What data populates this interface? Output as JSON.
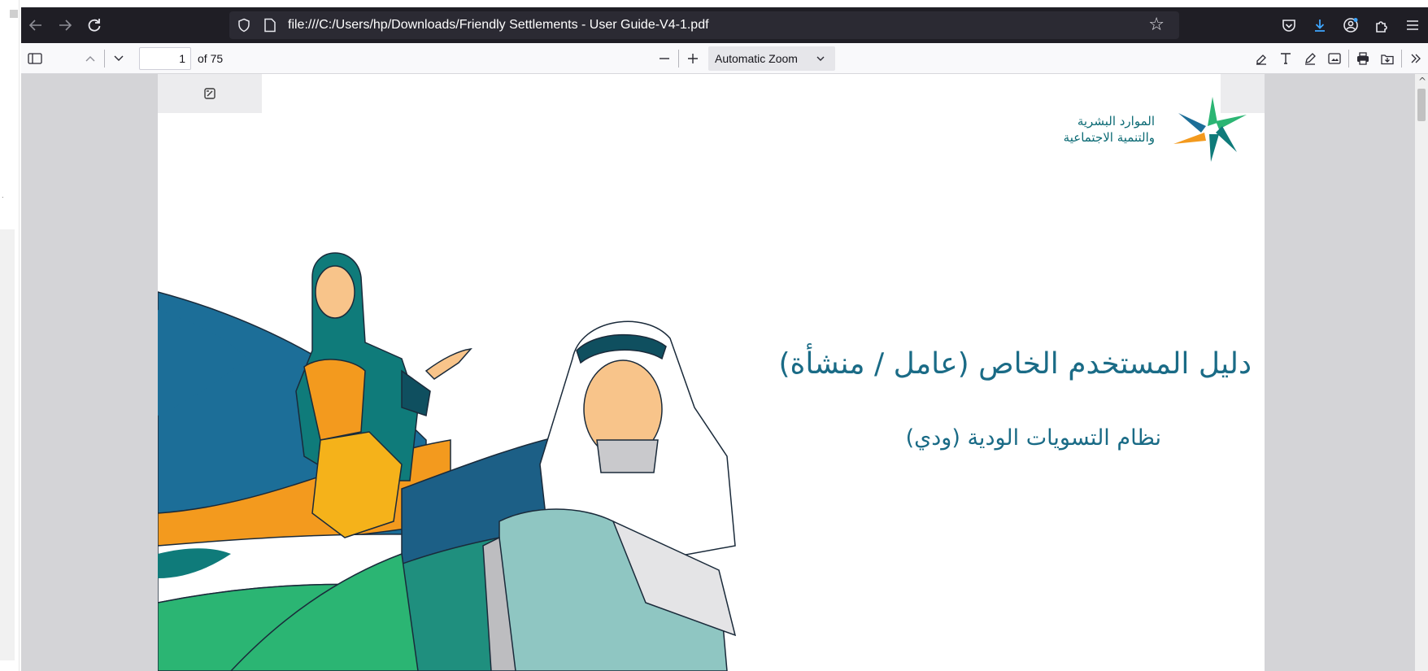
{
  "browser": {
    "url": "file:///C:/Users/hp/Downloads/Friendly Settlements - User Guide-V4-1.pdf"
  },
  "pdf_toolbar": {
    "page_number": "1",
    "page_count": "of 75",
    "zoom": "Automatic Zoom"
  },
  "document": {
    "logo_line1": "الموارد البشرية",
    "logo_line2": "والتنمية الاجتماعية",
    "title": "دليل المستخدم الخاص (عامل / منشأة)",
    "subtitle": "نظام التسويات الودية (ودي)"
  },
  "colors": {
    "teal": "#0f7b7a",
    "blue": "#1c6e98",
    "green": "#2bb573",
    "orange": "#f39a1e",
    "light_teal": "#8fc6c2",
    "title_color": "#1a6b86"
  }
}
